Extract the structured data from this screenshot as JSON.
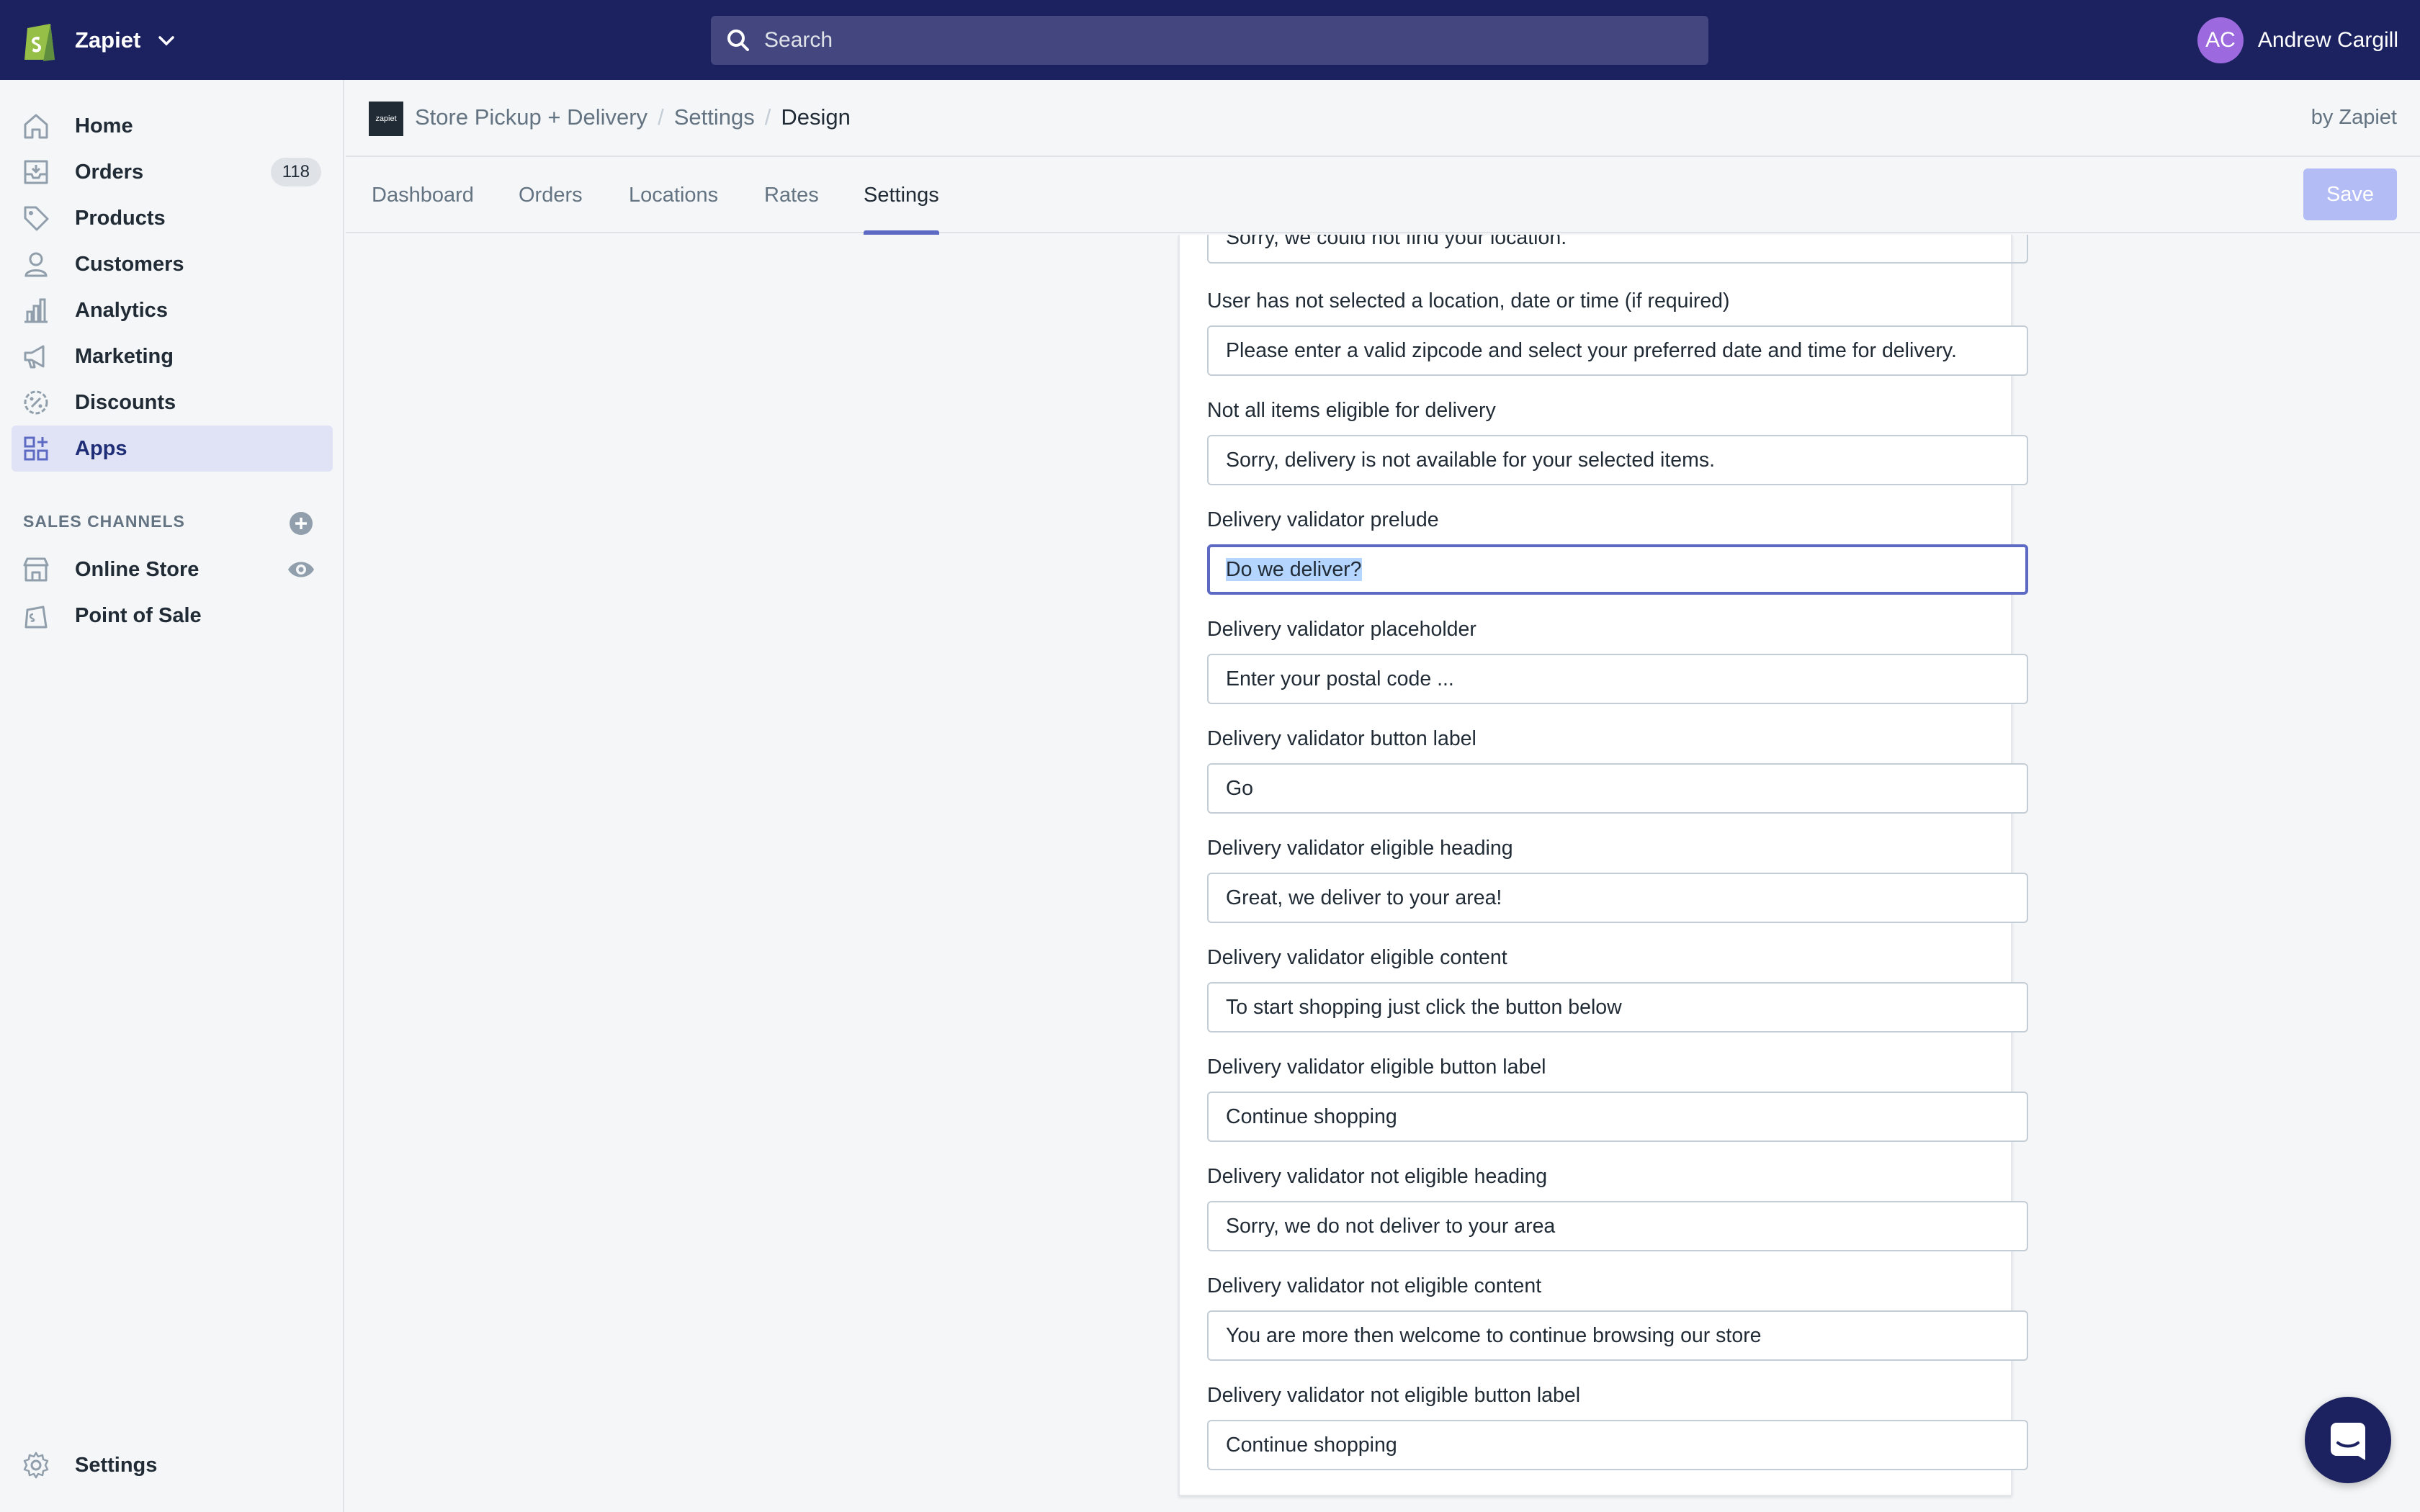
{
  "topbar": {
    "store_name": "Zapiet",
    "search_placeholder": "Search",
    "user_initials": "AC",
    "user_name": "Andrew Cargill",
    "colors": {
      "topbar": "#1c2260",
      "avatar": "#9c6ade"
    }
  },
  "sidebar": {
    "items": [
      {
        "label": "Home",
        "icon": "home-icon"
      },
      {
        "label": "Orders",
        "icon": "orders-icon",
        "badge": "118"
      },
      {
        "label": "Products",
        "icon": "tag-icon"
      },
      {
        "label": "Customers",
        "icon": "person-icon"
      },
      {
        "label": "Analytics",
        "icon": "bar-chart-icon"
      },
      {
        "label": "Marketing",
        "icon": "megaphone-icon"
      },
      {
        "label": "Discounts",
        "icon": "discount-icon"
      },
      {
        "label": "Apps",
        "icon": "apps-icon",
        "active": true
      }
    ],
    "channels_title": "SALES CHANNELS",
    "channels": [
      {
        "label": "Online Store",
        "icon": "store-icon"
      },
      {
        "label": "Point of Sale",
        "icon": "pos-bag-icon"
      }
    ],
    "settings_label": "Settings"
  },
  "app_header": {
    "logo_text": "zapiet",
    "breadcrumb": [
      "Store Pickup + Delivery",
      "Settings",
      "Design"
    ],
    "by": "by Zapiet"
  },
  "tabs": {
    "items": [
      "Dashboard",
      "Orders",
      "Locations",
      "Rates",
      "Settings"
    ],
    "active": "Settings",
    "save_label": "Save",
    "accent": "#5c6ac4"
  },
  "form": {
    "partial_value": "Sorry, we could not find your location.",
    "fields": [
      {
        "label": "User has not selected a location, date or time (if required)",
        "value": "Please enter a valid zipcode and select your preferred date and time for delivery."
      },
      {
        "label": "Not all items eligible for delivery",
        "value": "Sorry, delivery is not available for your selected items."
      },
      {
        "label": "Delivery validator prelude",
        "value": "Do we deliver?",
        "focused": true
      },
      {
        "label": "Delivery validator placeholder",
        "value": "Enter your postal code ..."
      },
      {
        "label": "Delivery validator button label",
        "value": "Go"
      },
      {
        "label": "Delivery validator eligible heading",
        "value": "Great, we deliver to your area!"
      },
      {
        "label": "Delivery validator eligible content",
        "value": "To start shopping just click the button below"
      },
      {
        "label": "Delivery validator eligible button label",
        "value": "Continue shopping"
      },
      {
        "label": "Delivery validator not eligible heading",
        "value": "Sorry, we do not deliver to your area"
      },
      {
        "label": "Delivery validator not eligible content",
        "value": "You are more then welcome to continue browsing our store"
      },
      {
        "label": "Delivery validator not eligible button label",
        "value": "Continue shopping"
      }
    ]
  },
  "chat": {
    "icon": "chat-icon"
  }
}
